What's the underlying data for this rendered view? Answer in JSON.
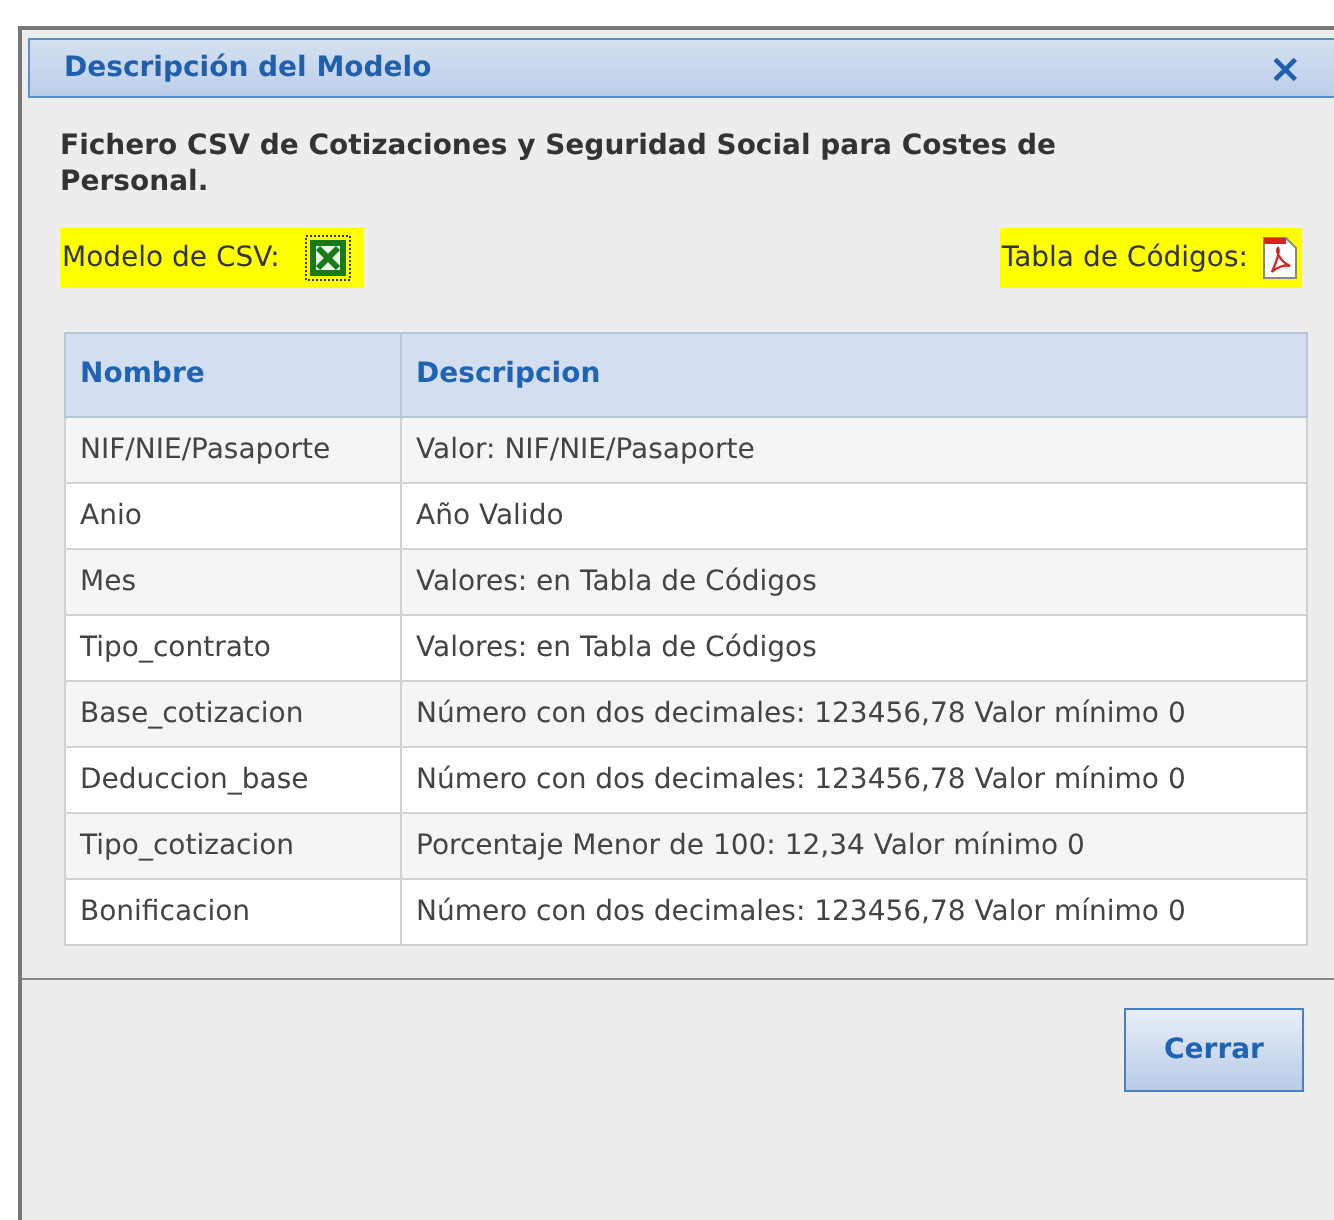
{
  "dialog": {
    "title": "Descripción del Modelo",
    "close": "×"
  },
  "description": "Fichero CSV de Cotizaciones y Seguridad Social para Costes de Personal.",
  "csv_label": "Modelo de CSV:",
  "codes_label": "Tabla de Códigos:",
  "table": {
    "columns": [
      "Nombre",
      "Descripcion"
    ],
    "rows": [
      [
        "NIF/NIE/Pasaporte",
        "Valor: NIF/NIE/Pasaporte"
      ],
      [
        "Anio",
        "Año Valido"
      ],
      [
        "Mes",
        "Valores: en Tabla de Códigos"
      ],
      [
        "Tipo_contrato",
        "Valores: en Tabla de Códigos"
      ],
      [
        "Base_cotizacion",
        "Número con dos decimales: 123456,78 Valor mínimo 0"
      ],
      [
        "Deduccion_base",
        "Número con dos decimales: 123456,78 Valor mínimo 0"
      ],
      [
        "Tipo_cotizacion",
        "Porcentaje Menor de 100: 12,34 Valor mínimo 0"
      ],
      [
        "Bonificacion",
        "Número con dos decimales: 123456,78 Valor mínimo 0"
      ]
    ]
  },
  "buttons": [
    "Cerrar"
  ]
}
